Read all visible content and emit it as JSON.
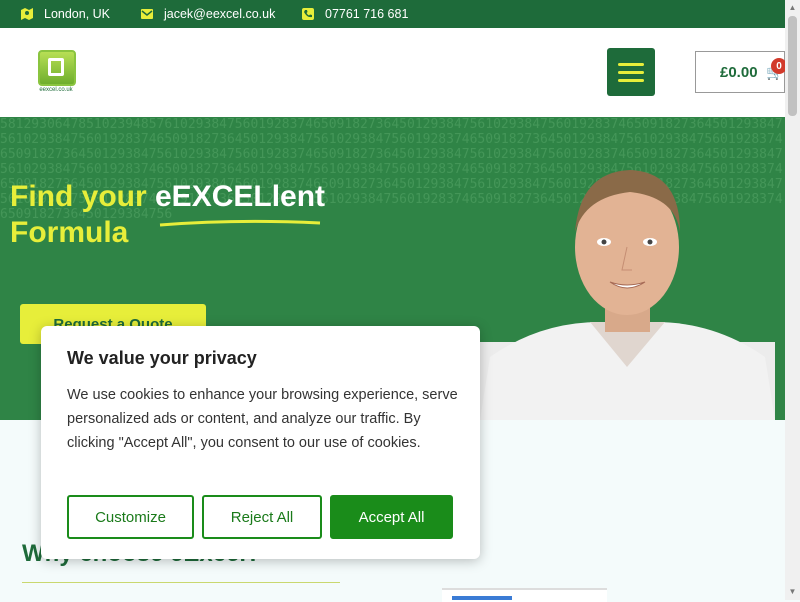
{
  "topbar": {
    "location": "London, UK",
    "email": "jacek@eexcel.co.uk",
    "phone": "07761 716 681"
  },
  "header": {
    "logo_text": "eexcel.co.uk",
    "cart_total": "£0.00",
    "cart_count": "0"
  },
  "hero": {
    "title_prefix": "Find your ",
    "title_highlight": "eEXCELlent",
    "title_suffix": "Formula",
    "quote_button": "Request a Quote",
    "background_digits": "5812930647851023948576102938475601928374650918273645012938475610293847560192837465091827364501293847561029384756019283746509182736450129384756102938475601928374650918273645012938475610293847560192837465091827364501293847561029384756019283746509182736450129384756102938475601928374650918273645012938475610293847560192837465091827364501293847561029384756019283746509182736450129384756102938475601928374650918273645012938475610293847560192837465091827364501293847561029384756019283746509182736450129384756102938475601928374650918273645012938475610293847560192837465091827364501293847561029384756019283746509182736450129384756"
  },
  "section": {
    "why_title": "Why choose eExcel?"
  },
  "cookie": {
    "title": "We value your privacy",
    "body": "We use cookies to enhance your browsing experience, serve personalized ads or content, and analyze our traffic. By clicking \"Accept All\", you consent to our use of cookies.",
    "customize": "Customize",
    "reject": "Reject All",
    "accept": "Accept All"
  },
  "colors": {
    "brand_green": "#1e6b3a",
    "accent_yellow": "#e7ee3a",
    "cookie_green": "#1a8c1a"
  },
  "icons": {
    "location": "map-icon",
    "email": "mail-icon",
    "phone": "phone-icon",
    "menu": "hamburger-icon",
    "cart": "cart-icon"
  }
}
